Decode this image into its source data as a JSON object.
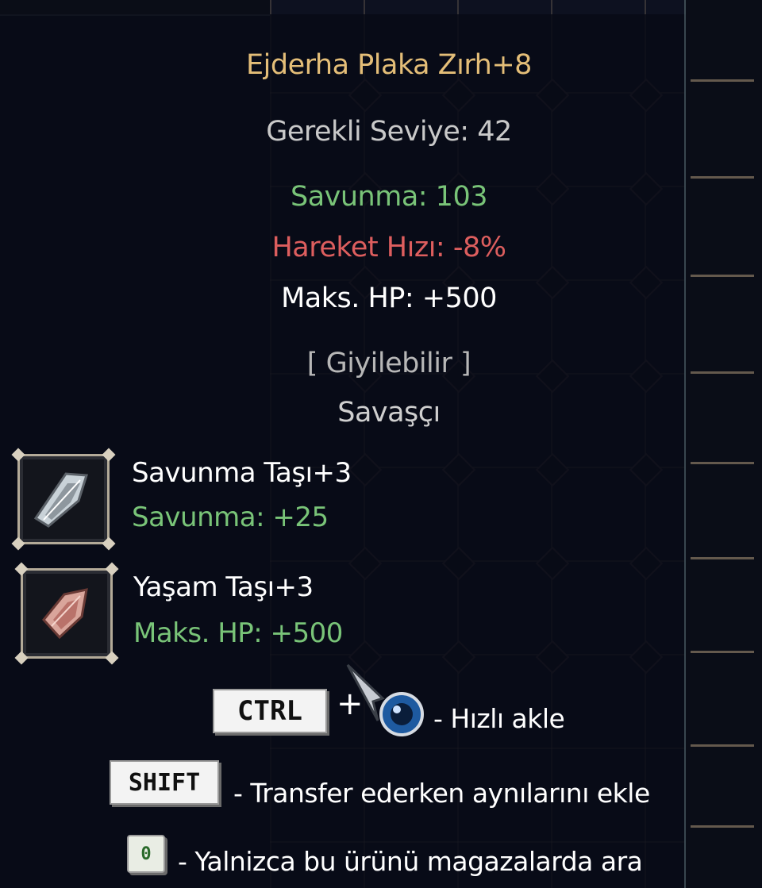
{
  "item": {
    "name": "Ejderha Plaka Zırh+8",
    "required_level": "Gerekli Seviye: 42",
    "defense": "Savunma: 103",
    "move_speed": "Hareket Hızı: -8%",
    "max_hp": "Maks. HP: +500",
    "wearable": "[ Giyilebilir ]",
    "class": "Savaşçı"
  },
  "sockets": [
    {
      "name": "Savunma Taşı+3",
      "stat": "Savunma: +25",
      "icon": "defense-stone-icon"
    },
    {
      "name": "Yaşam Taşı+3",
      "stat": "Maks. HP: +500",
      "icon": "life-stone-icon"
    }
  ],
  "hints": {
    "ctrl_key": "CTRL",
    "plus": "+",
    "ctrl_text": "- Hızlı akle",
    "shift_key": "SHIFT",
    "shift_text": "- Transfer ederken aynılarını ekle",
    "search_key": "0",
    "search_text": "- Yalnizca bu ürünü magazalarda ara"
  },
  "colors": {
    "title": "#e4be78",
    "positive": "#79c478",
    "negative": "#dd5e5e",
    "neutral": "#c9c9c9"
  }
}
